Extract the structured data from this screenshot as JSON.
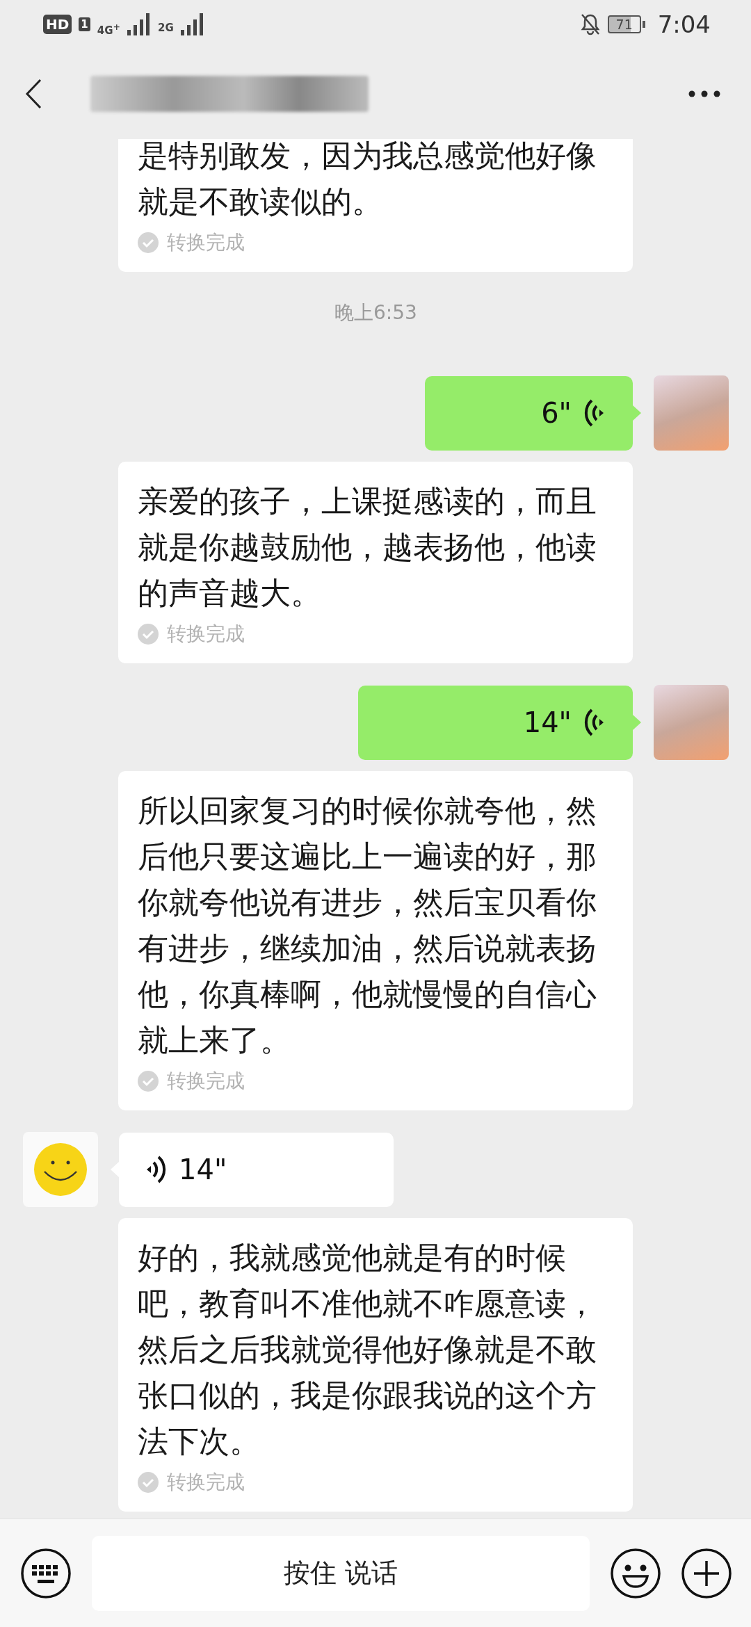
{
  "status_bar": {
    "hd_badge": "HD",
    "sim_badge": "1",
    "network_1": "4G$^{+}$",
    "network_2": "2G",
    "battery": "71",
    "time": "7:04"
  },
  "messages": [
    {
      "kind": "transcript",
      "text": "是特别敢发，因为我总感觉他好像就是不敢读似的。",
      "status": "转换完成"
    },
    {
      "kind": "timestamp",
      "text": "晚上6:53"
    },
    {
      "kind": "voice_out",
      "duration": "6\""
    },
    {
      "kind": "transcript",
      "text": "亲爱的孩子，上课挺感读的，而且就是你越鼓励他，越表扬他，他读的声音越大。",
      "status": "转换完成"
    },
    {
      "kind": "voice_out",
      "duration": "14\""
    },
    {
      "kind": "transcript",
      "text": "所以回家复习的时候你就夸他，然后他只要这遍比上一遍读的好，那你就夸他说有进步，然后宝贝看你有进步，继续加油，然后说就表扬他，你真棒啊，他就慢慢的自信心就上来了。",
      "status": "转换完成"
    },
    {
      "kind": "voice_in",
      "duration": "14\""
    },
    {
      "kind": "transcript",
      "text": "好的，我就感觉他就是有的时候吧，教育叫不准他就不咋愿意读，然后之后我就觉得他好像就是不敢张口似的，我是你跟我说的这个方法下次。",
      "status": "转换完成"
    }
  ],
  "input_bar": {
    "hold_to_talk": "按住 说话"
  }
}
